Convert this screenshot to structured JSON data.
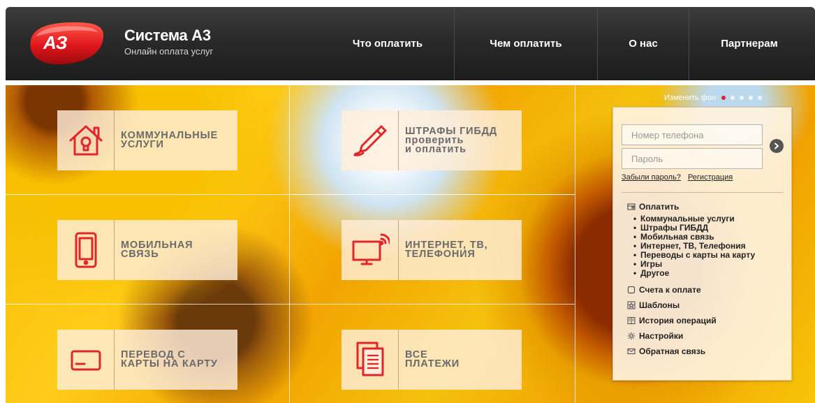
{
  "brand": {
    "logo_text": "АЗ",
    "title": "Система А3",
    "subtitle": "Онлайн оплата услуг"
  },
  "nav": [
    "Что оплатить",
    "Чем оплатить",
    "О нас",
    "Партнерам"
  ],
  "tiles": [
    {
      "label": "КОММУНАЛЬНЫЕ\nУСЛУГИ",
      "icon": "house-bulb-icon"
    },
    {
      "label": "ШТРАФЫ ГИБДД\nпроверить\nи оплатить",
      "icon": "pen-icon"
    },
    {
      "label": "МОБИЛЬНАЯ\nСВЯЗЬ",
      "icon": "mobile-phone-icon"
    },
    {
      "label": "ИНТЕРНЕТ, ТВ,\nТЕЛЕФОНИЯ",
      "icon": "tv-signal-icon"
    },
    {
      "label": "ПЕРЕВОД С\nКАРТЫ НА КАРТУ",
      "icon": "card-icon"
    },
    {
      "label": "ВСЕ\nПЛАТЕЖИ",
      "icon": "documents-icon"
    }
  ],
  "background_switch": {
    "label": "Изменить фон",
    "dots": 5,
    "active_dot": 1,
    "active_color": "#d9232e"
  },
  "login": {
    "phone_placeholder": "Номер телефона",
    "password_placeholder": "Пароль",
    "forgot_label": "Забыли пароль?",
    "register_label": "Регистрация"
  },
  "menu": {
    "pay_label": "Оплатить",
    "pay_items": [
      "Коммунальные услуги",
      "Штрафы ГИБДД",
      "Мобильная связь",
      "Интернет, ТВ, Телефония",
      "Переводы с карты на карту",
      "Игры",
      "Другое"
    ],
    "invoices_label": "Счета к оплате",
    "templates_label": "Шаблоны",
    "history_label": "История операций",
    "settings_label": "Настройки",
    "feedback_label": "Обратная связь"
  },
  "colors": {
    "brand_red": "#e02a2a",
    "header_dark": "#2a2a2a",
    "tile_text": "#6a6a6a"
  }
}
